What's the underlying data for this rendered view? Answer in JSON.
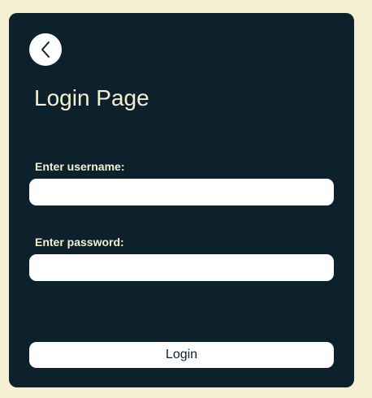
{
  "page": {
    "title": "Login Page",
    "back_icon": "chevron-left-icon"
  },
  "form": {
    "username_label": "Enter username:",
    "username_value": "",
    "password_label": "Enter password:",
    "password_value": "",
    "submit_label": "Login"
  },
  "colors": {
    "background": "#f5efd3",
    "card": "#0c212b",
    "text_light": "#f5efd3",
    "input_bg": "#ffffff"
  }
}
